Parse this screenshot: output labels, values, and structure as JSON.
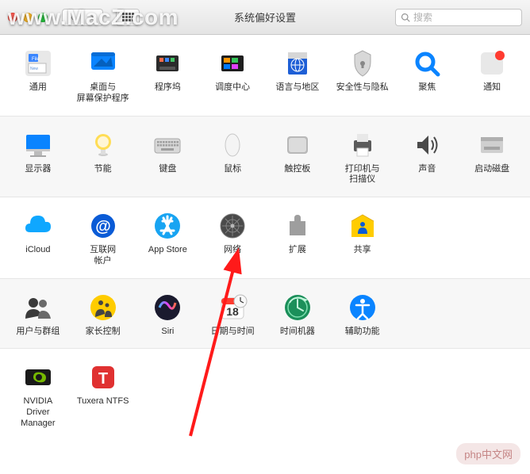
{
  "window": {
    "title": "系统偏好设置"
  },
  "search": {
    "placeholder": "搜索"
  },
  "watermark": "www.MacZ.com",
  "php_badge": "php中文网",
  "sections": [
    {
      "style": "plain",
      "items": [
        {
          "id": "general",
          "label": "通用"
        },
        {
          "id": "desktop",
          "label": "桌面与\n屏幕保护程序"
        },
        {
          "id": "dock",
          "label": "程序坞"
        },
        {
          "id": "mission",
          "label": "调度中心"
        },
        {
          "id": "language",
          "label": "语言与地区"
        },
        {
          "id": "security",
          "label": "安全性与隐私"
        },
        {
          "id": "spotlight",
          "label": "聚焦"
        },
        {
          "id": "notifications",
          "label": "通知"
        }
      ]
    },
    {
      "style": "alt",
      "items": [
        {
          "id": "display",
          "label": "显示器"
        },
        {
          "id": "energy",
          "label": "节能"
        },
        {
          "id": "keyboard",
          "label": "键盘"
        },
        {
          "id": "mouse",
          "label": "鼠标"
        },
        {
          "id": "trackpad",
          "label": "触控板"
        },
        {
          "id": "printer",
          "label": "打印机与\n扫描仪"
        },
        {
          "id": "sound",
          "label": "声音"
        },
        {
          "id": "startup",
          "label": "启动磁盘"
        }
      ]
    },
    {
      "style": "plain",
      "items": [
        {
          "id": "icloud",
          "label": "iCloud"
        },
        {
          "id": "internet",
          "label": "互联网\n帐户"
        },
        {
          "id": "appstore",
          "label": "App Store"
        },
        {
          "id": "network",
          "label": "网络"
        },
        {
          "id": "extensions",
          "label": "扩展"
        },
        {
          "id": "sharing",
          "label": "共享"
        }
      ]
    },
    {
      "style": "alt",
      "items": [
        {
          "id": "users",
          "label": "用户与群组"
        },
        {
          "id": "parental",
          "label": "家长控制"
        },
        {
          "id": "siri",
          "label": "Siri"
        },
        {
          "id": "datetime",
          "label": "日期与时间"
        },
        {
          "id": "timemachine",
          "label": "时间机器"
        },
        {
          "id": "accessibility",
          "label": "辅助功能"
        }
      ]
    },
    {
      "style": "plain",
      "items": [
        {
          "id": "nvidia",
          "label": "NVIDIA\nDriver Manager"
        },
        {
          "id": "tuxera",
          "label": "Tuxera NTFS"
        }
      ]
    }
  ]
}
